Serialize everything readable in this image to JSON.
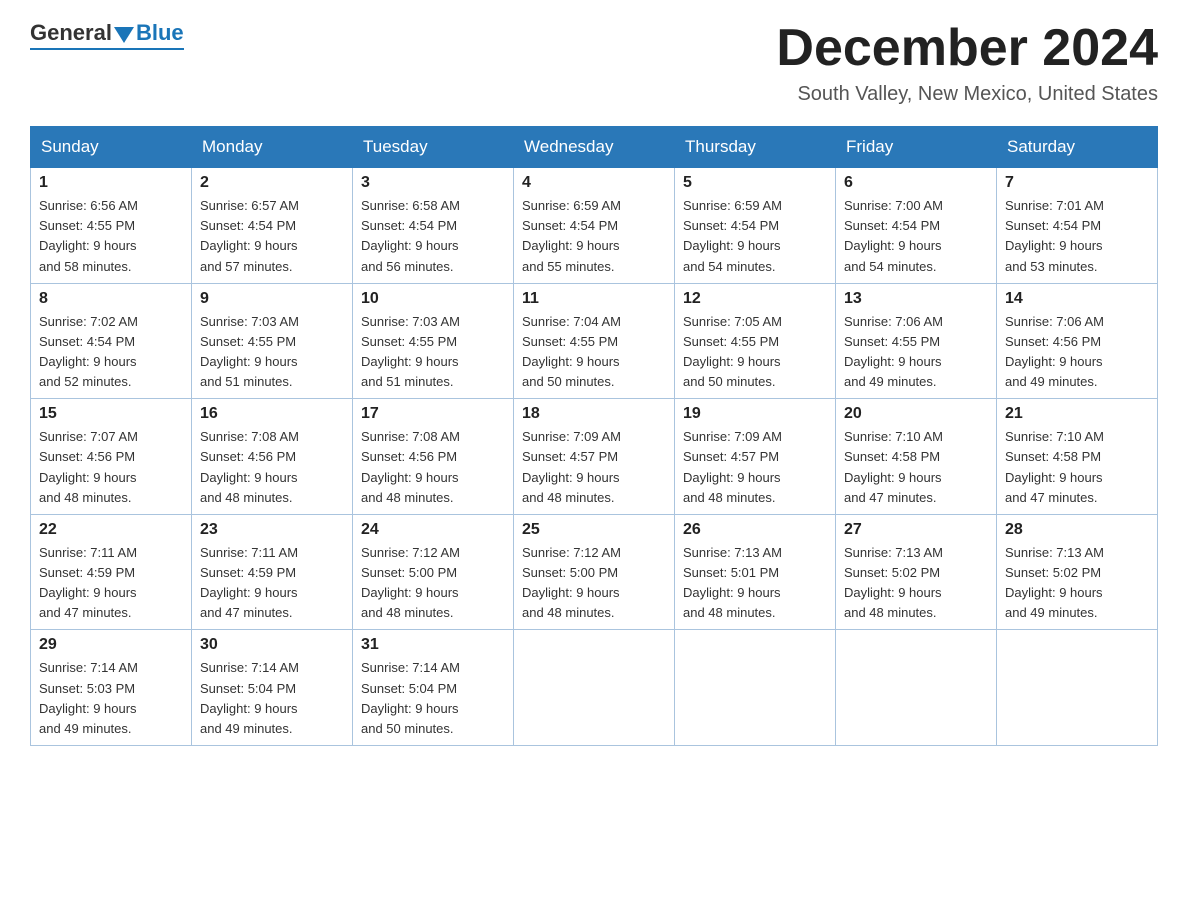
{
  "header": {
    "logo": {
      "general": "General",
      "blue": "Blue"
    },
    "title": "December 2024",
    "location": "South Valley, New Mexico, United States"
  },
  "weekdays": [
    "Sunday",
    "Monday",
    "Tuesday",
    "Wednesday",
    "Thursday",
    "Friday",
    "Saturday"
  ],
  "weeks": [
    [
      {
        "day": "1",
        "sunrise": "6:56 AM",
        "sunset": "4:55 PM",
        "daylight": "9 hours and 58 minutes."
      },
      {
        "day": "2",
        "sunrise": "6:57 AM",
        "sunset": "4:54 PM",
        "daylight": "9 hours and 57 minutes."
      },
      {
        "day": "3",
        "sunrise": "6:58 AM",
        "sunset": "4:54 PM",
        "daylight": "9 hours and 56 minutes."
      },
      {
        "day": "4",
        "sunrise": "6:59 AM",
        "sunset": "4:54 PM",
        "daylight": "9 hours and 55 minutes."
      },
      {
        "day": "5",
        "sunrise": "6:59 AM",
        "sunset": "4:54 PM",
        "daylight": "9 hours and 54 minutes."
      },
      {
        "day": "6",
        "sunrise": "7:00 AM",
        "sunset": "4:54 PM",
        "daylight": "9 hours and 54 minutes."
      },
      {
        "day": "7",
        "sunrise": "7:01 AM",
        "sunset": "4:54 PM",
        "daylight": "9 hours and 53 minutes."
      }
    ],
    [
      {
        "day": "8",
        "sunrise": "7:02 AM",
        "sunset": "4:54 PM",
        "daylight": "9 hours and 52 minutes."
      },
      {
        "day": "9",
        "sunrise": "7:03 AM",
        "sunset": "4:55 PM",
        "daylight": "9 hours and 51 minutes."
      },
      {
        "day": "10",
        "sunrise": "7:03 AM",
        "sunset": "4:55 PM",
        "daylight": "9 hours and 51 minutes."
      },
      {
        "day": "11",
        "sunrise": "7:04 AM",
        "sunset": "4:55 PM",
        "daylight": "9 hours and 50 minutes."
      },
      {
        "day": "12",
        "sunrise": "7:05 AM",
        "sunset": "4:55 PM",
        "daylight": "9 hours and 50 minutes."
      },
      {
        "day": "13",
        "sunrise": "7:06 AM",
        "sunset": "4:55 PM",
        "daylight": "9 hours and 49 minutes."
      },
      {
        "day": "14",
        "sunrise": "7:06 AM",
        "sunset": "4:56 PM",
        "daylight": "9 hours and 49 minutes."
      }
    ],
    [
      {
        "day": "15",
        "sunrise": "7:07 AM",
        "sunset": "4:56 PM",
        "daylight": "9 hours and 48 minutes."
      },
      {
        "day": "16",
        "sunrise": "7:08 AM",
        "sunset": "4:56 PM",
        "daylight": "9 hours and 48 minutes."
      },
      {
        "day": "17",
        "sunrise": "7:08 AM",
        "sunset": "4:56 PM",
        "daylight": "9 hours and 48 minutes."
      },
      {
        "day": "18",
        "sunrise": "7:09 AM",
        "sunset": "4:57 PM",
        "daylight": "9 hours and 48 minutes."
      },
      {
        "day": "19",
        "sunrise": "7:09 AM",
        "sunset": "4:57 PM",
        "daylight": "9 hours and 48 minutes."
      },
      {
        "day": "20",
        "sunrise": "7:10 AM",
        "sunset": "4:58 PM",
        "daylight": "9 hours and 47 minutes."
      },
      {
        "day": "21",
        "sunrise": "7:10 AM",
        "sunset": "4:58 PM",
        "daylight": "9 hours and 47 minutes."
      }
    ],
    [
      {
        "day": "22",
        "sunrise": "7:11 AM",
        "sunset": "4:59 PM",
        "daylight": "9 hours and 47 minutes."
      },
      {
        "day": "23",
        "sunrise": "7:11 AM",
        "sunset": "4:59 PM",
        "daylight": "9 hours and 47 minutes."
      },
      {
        "day": "24",
        "sunrise": "7:12 AM",
        "sunset": "5:00 PM",
        "daylight": "9 hours and 48 minutes."
      },
      {
        "day": "25",
        "sunrise": "7:12 AM",
        "sunset": "5:00 PM",
        "daylight": "9 hours and 48 minutes."
      },
      {
        "day": "26",
        "sunrise": "7:13 AM",
        "sunset": "5:01 PM",
        "daylight": "9 hours and 48 minutes."
      },
      {
        "day": "27",
        "sunrise": "7:13 AM",
        "sunset": "5:02 PM",
        "daylight": "9 hours and 48 minutes."
      },
      {
        "day": "28",
        "sunrise": "7:13 AM",
        "sunset": "5:02 PM",
        "daylight": "9 hours and 49 minutes."
      }
    ],
    [
      {
        "day": "29",
        "sunrise": "7:14 AM",
        "sunset": "5:03 PM",
        "daylight": "9 hours and 49 minutes."
      },
      {
        "day": "30",
        "sunrise": "7:14 AM",
        "sunset": "5:04 PM",
        "daylight": "9 hours and 49 minutes."
      },
      {
        "day": "31",
        "sunrise": "7:14 AM",
        "sunset": "5:04 PM",
        "daylight": "9 hours and 50 minutes."
      },
      null,
      null,
      null,
      null
    ]
  ],
  "labels": {
    "sunrise": "Sunrise:",
    "sunset": "Sunset:",
    "daylight": "Daylight:"
  }
}
